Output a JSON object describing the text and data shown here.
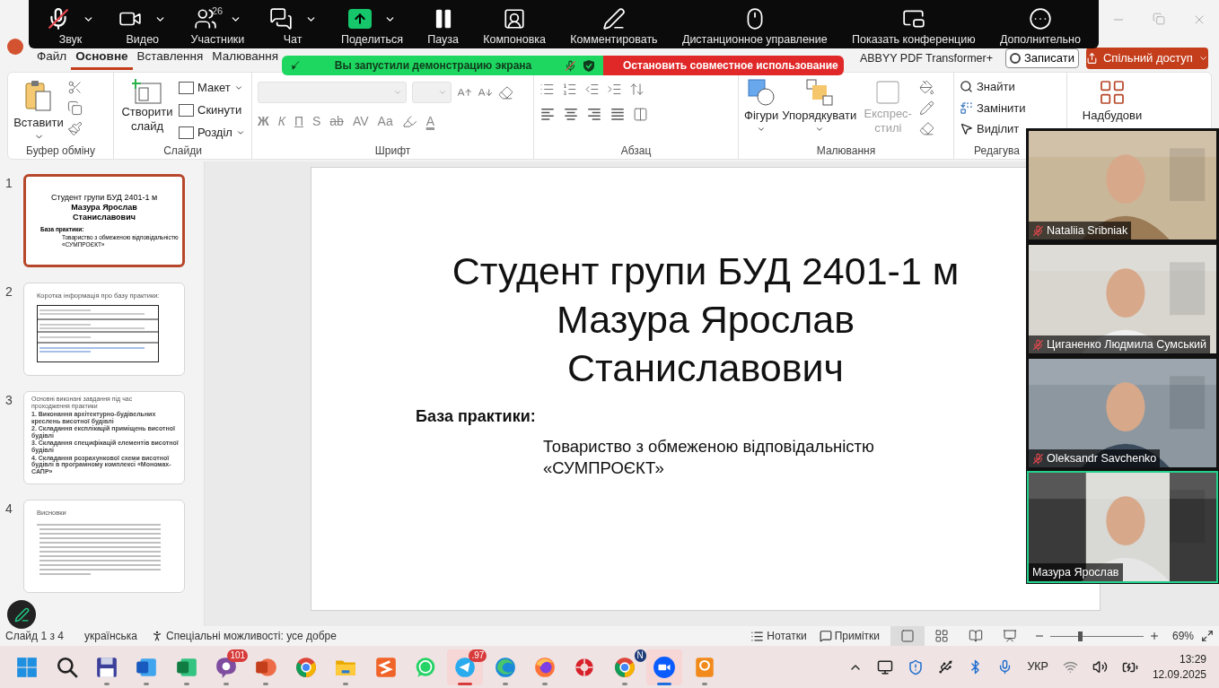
{
  "zoom_toolbar": {
    "items": [
      {
        "label": "Звук",
        "kind": "mic",
        "muted": true,
        "menu": true
      },
      {
        "label": "Видео",
        "kind": "video",
        "menu": true
      },
      {
        "label": "Участники",
        "kind": "participants",
        "count": "26",
        "menu": true
      },
      {
        "label": "Чат",
        "kind": "chat",
        "menu": true
      },
      {
        "label": "Поделиться",
        "kind": "share",
        "menu": true
      },
      {
        "label": "Пауза",
        "kind": "pause",
        "menu": false
      },
      {
        "label": "Компоновка",
        "kind": "layout",
        "menu": false
      },
      {
        "label": "Комментировать",
        "kind": "annotate",
        "menu": false
      },
      {
        "label": "Дистанционное управление",
        "kind": "remote",
        "menu": false
      },
      {
        "label": "Показать конференцию",
        "kind": "meeting",
        "menu": false
      },
      {
        "label": "Дополнительно",
        "kind": "more",
        "menu": false
      }
    ]
  },
  "share_banner": {
    "message": "Вы запустили демонстрацию экрана",
    "stop": "Остановить совместное использование"
  },
  "tabs": [
    {
      "label": "Файл",
      "selected": false
    },
    {
      "label": "Основне",
      "selected": true
    },
    {
      "label": "Вставлення",
      "selected": false
    },
    {
      "label": "Малювання",
      "selected": false
    }
  ],
  "header_right": {
    "addin": "ABBYY PDF Transformer+",
    "record": "Записати",
    "share": "Спільний доступ"
  },
  "ribbon": {
    "clipboard": {
      "paste": "Вставити",
      "label": "Буфер обміну"
    },
    "slides": {
      "new_slide": "Створити слайд",
      "layout": "Макет",
      "reset": "Скинути",
      "section": "Розділ",
      "label": "Слайди"
    },
    "font": {
      "format": [
        "Ж",
        "К",
        "П",
        "S",
        "ab",
        "AV",
        "Aa"
      ],
      "color_letter": "A",
      "label": "Шрифт"
    },
    "paragraph": {
      "label": "Абзац"
    },
    "drawing": {
      "shapes": "Фігури",
      "arrange": "Упорядкувати",
      "quick_styles": "Експрес-стилі",
      "quick_styles_disabled": true,
      "label": "Малювання"
    },
    "editing": {
      "find": "Знайти",
      "replace": "Замінити",
      "select": "Виділит",
      "label": "Редагува"
    },
    "addins": {
      "label": "Надбудови"
    }
  },
  "thumbnails": [
    {
      "number": "1",
      "selected": true,
      "kind": "title",
      "title_lines": [
        "Студент групи БУД 2401-1 м",
        "Мазура Ярослав",
        "Станиславович"
      ],
      "label": "База практики:",
      "company": "Товариство з обмеженою відповідальністю «СУМПРОЄКТ»"
    },
    {
      "number": "2",
      "selected": false,
      "kind": "table",
      "title": "Коротка інформація про базу практики:"
    },
    {
      "number": "3",
      "selected": false,
      "kind": "bullets",
      "title": "Основні виконані завдання під час проходження практики",
      "bullets": [
        "1. Виконання архітектурно-будівельних креслень висотної будівлі",
        "2. Складання експлікацій приміщень висотної будівлі",
        "3. Складання специфікацій елементів висотної будівлі",
        "4. Складання розрахункової схеми висотної будівлі в програмному комплексі «Мономах-САПР»"
      ]
    },
    {
      "number": "4",
      "selected": false,
      "kind": "text",
      "title": "Висновки"
    }
  ],
  "slide": {
    "title_lines": [
      "Студент групи БУД 2401-1 м",
      "Мазура Ярослав",
      "Станиславович"
    ],
    "label": "База практики:",
    "company_lines": [
      "Товариство з обмеженою відповідальністю",
      "«СУМПРОЄКТ»"
    ]
  },
  "video_tiles": [
    {
      "name": "Nataliia Sribniak",
      "muted": true,
      "selected": false
    },
    {
      "name": "Циганенко Людмила Сумський",
      "muted": true,
      "selected": false
    },
    {
      "name": "Oleksandr Savchenko",
      "muted": true,
      "selected": false
    },
    {
      "name": "Мазура Ярослав",
      "muted": false,
      "selected": true
    }
  ],
  "status_bar": {
    "slide": "Слайд 1 з 4",
    "language": "українська",
    "accessibility": "Спеціальні можливості: усе добре",
    "notes": "Нотатки",
    "comments": "Примітки",
    "views": [
      {
        "kind": "normal",
        "selected": true
      },
      {
        "kind": "sorter",
        "selected": false
      },
      {
        "kind": "reading",
        "selected": false
      },
      {
        "kind": "slideshow",
        "selected": false
      }
    ],
    "zoom": {
      "level": 0.32,
      "reading": "69%"
    }
  },
  "taskbar": {
    "apps": [
      {
        "kind": "start",
        "running": false,
        "active": false
      },
      {
        "kind": "search",
        "running": false,
        "active": false
      },
      {
        "kind": "floppy",
        "running": true,
        "active": false
      },
      {
        "kind": "word",
        "running": true,
        "active": false
      },
      {
        "kind": "excel",
        "running": true,
        "active": false
      },
      {
        "kind": "viber",
        "running": true,
        "active": false,
        "badge": "101"
      },
      {
        "kind": "powerpoint",
        "running": true,
        "active": false
      },
      {
        "kind": "chrome",
        "running": false,
        "active": false
      },
      {
        "kind": "explorer",
        "running": true,
        "active": false
      },
      {
        "kind": "sublime",
        "running": false,
        "active": false
      },
      {
        "kind": "whatsapp",
        "running": false,
        "active": false
      },
      {
        "kind": "telegram",
        "running": true,
        "active": true,
        "badge": ".97"
      },
      {
        "kind": "edge",
        "running": true,
        "active": false
      },
      {
        "kind": "firefox",
        "running": true,
        "active": false
      },
      {
        "kind": "redapp",
        "running": false,
        "active": false
      },
      {
        "kind": "chrome",
        "running": true,
        "active": false,
        "badge": "N"
      },
      {
        "kind": "zoom",
        "running": true,
        "active": true
      },
      {
        "kind": "pdf",
        "running": true,
        "active": false
      }
    ],
    "tray": {
      "language": "УКР",
      "time": "13:29",
      "date": "12.09.2025"
    }
  }
}
